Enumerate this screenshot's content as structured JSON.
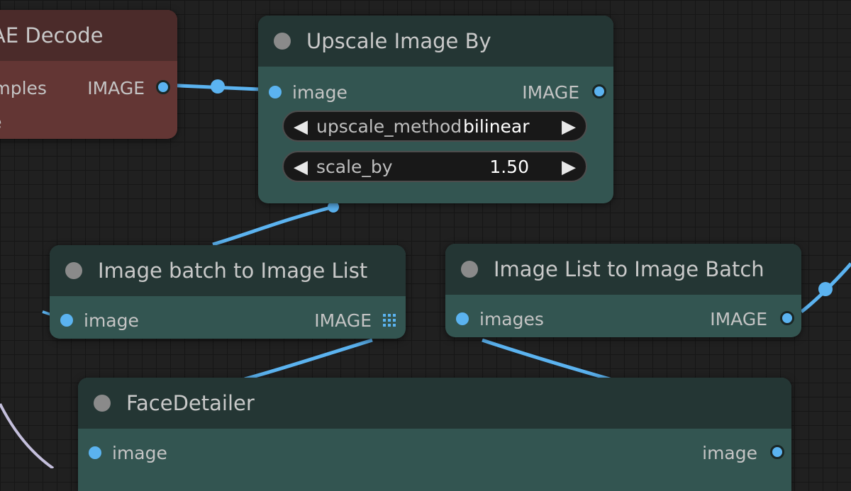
{
  "nodes": {
    "vae_decode": {
      "title": "VAE Decode",
      "input_samples": "samples",
      "input_vae": "vae",
      "output": "IMAGE"
    },
    "upscale": {
      "title": "Upscale Image By",
      "input": "image",
      "output": "IMAGE",
      "widgets": {
        "upscale_method": {
          "name": "upscale_method",
          "value": "bilinear"
        },
        "scale_by": {
          "name": "scale_by",
          "value": "1.50"
        }
      }
    },
    "batch_to_list": {
      "title": "Image batch to Image List",
      "input": "image",
      "output": "IMAGE"
    },
    "list_to_batch": {
      "title": "Image List to Image Batch",
      "input": "images",
      "output": "IMAGE"
    },
    "face_detailer": {
      "title": "FaceDetailer",
      "input": "image",
      "output": "image"
    }
  },
  "colors": {
    "wire": "#5bb3f0",
    "node_body": "#335551",
    "node_header": "#243634",
    "vae_body": "#633634",
    "canvas": "#202020"
  },
  "icons": {
    "arrow_left": "◀",
    "arrow_right": "▶",
    "list_output": "grid-icon"
  }
}
